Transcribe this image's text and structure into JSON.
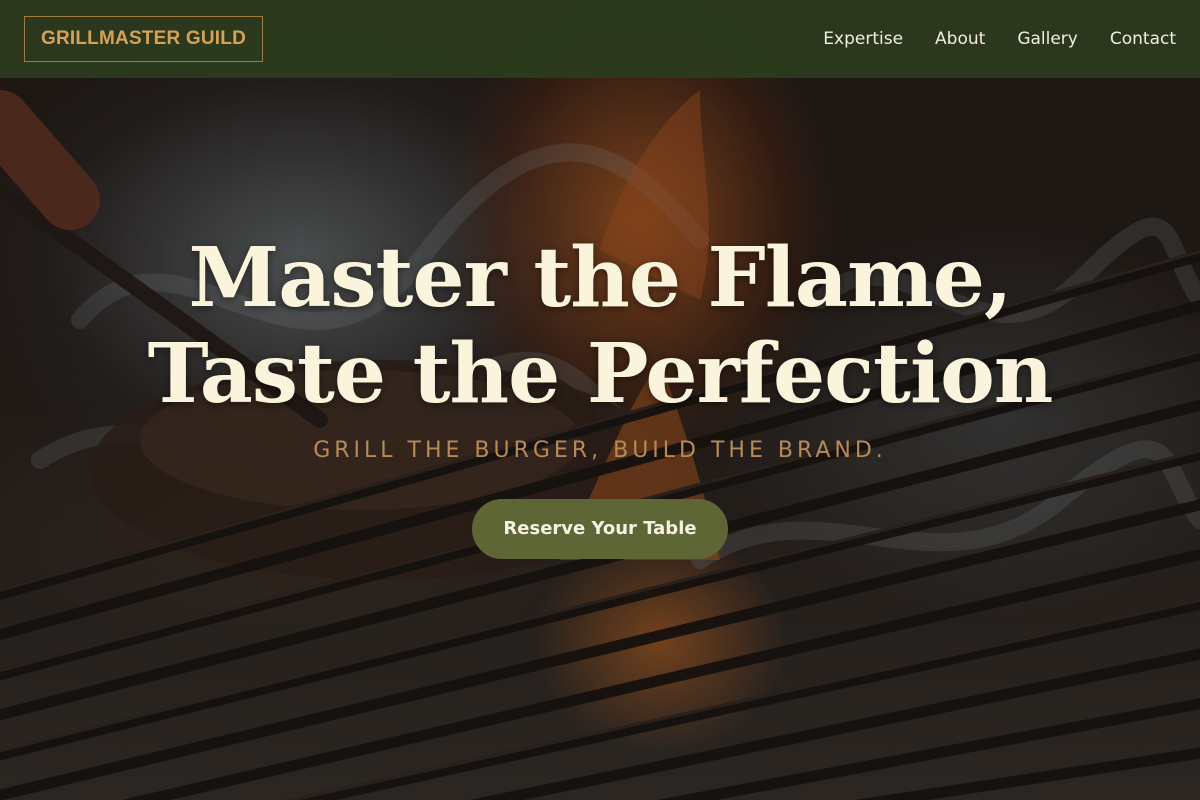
{
  "brand": {
    "logo_text": "GRILLMASTER GUILD"
  },
  "nav": {
    "links": [
      "Expertise",
      "About",
      "Gallery",
      "Contact"
    ]
  },
  "hero": {
    "headline_line1": "Master the Flame,",
    "headline_line2": "Taste the Perfection",
    "tagline": "GRILL THE BURGER, BUILD THE BRAND.",
    "cta_label": "Reserve Your Table",
    "background_image": "grill-flame-photo"
  },
  "colors": {
    "navbar": "#2c3a1e",
    "logo": "#d7a257",
    "headline": "#fbf4dc",
    "tagline": "#b78a56",
    "cta": "#5f6636"
  }
}
